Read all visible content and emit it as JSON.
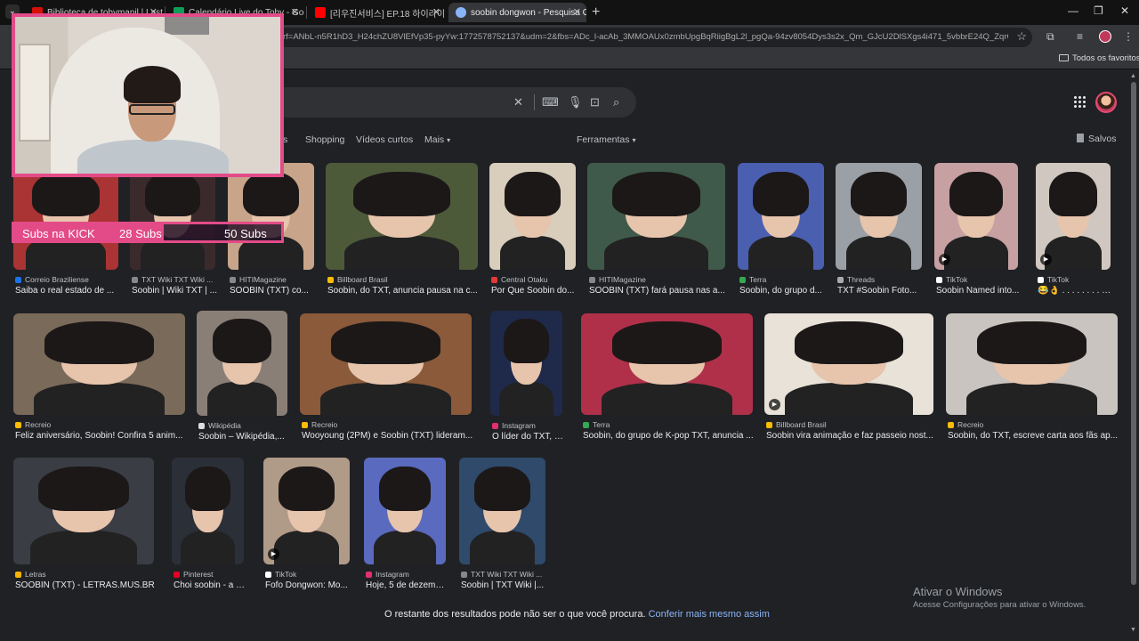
{
  "tabs": [
    {
      "title": "Biblioteca de tobymanil | Last.fm",
      "favicon_color": "#d51007"
    },
    {
      "title": "Calendário Live do Toby - Goo...",
      "favicon_color": "#0f9d58"
    },
    {
      "title": "[리우진서비스] EP.18 하이라이...",
      "favicon_color": "#ff0000"
    },
    {
      "title": "soobin dongwon - Pesquisa Go...",
      "favicon_color": "#8ab4f8"
    }
  ],
  "address_bar": {
    "url": "rf=ANbL-n5R1hD3_H24chZU8VlEfVp35-pyYw:1772578752137&udm=2&fbs=ADc_l-acAb_3MMOAUx0zmbUpgBqRiigBgL2l_pgQa-94zv8054Dys3s2x_Qm_GJcU2DlSXgs4i471_5vbbrE24Q_ZqrCatB7Y..."
  },
  "bookmarks": {
    "all_favorites": "Todos os favoritos"
  },
  "search": {
    "query": ""
  },
  "nav": {
    "images_partial": "s",
    "shopping": "Shopping",
    "short_videos": "Vídeos curtos",
    "more": "Mais",
    "tools": "Ferramentas",
    "saved": "Salvos"
  },
  "results": [
    {
      "source": "Correio Braziliense",
      "title": "Saiba o real estado de ...",
      "fav": "#1a73e8",
      "bg": "#a33",
      "video": false
    },
    {
      "source": "TXT Wiki TXT Wiki ...",
      "title": "Soobin | Wiki TXT | ...",
      "fav": "#888",
      "bg": "#3b2a2c",
      "video": false
    },
    {
      "source": "HITIMagazine",
      "title": "SOOBIN (TXT) co...",
      "fav": "#888",
      "bg": "#c8a58a",
      "video": false
    },
    {
      "source": "Billboard Brasil",
      "title": "Soobin, do TXT, anuncia pausa na c...",
      "fav": "#fbbc05",
      "bg": "#4d5a3a",
      "video": false
    },
    {
      "source": "Central Otaku",
      "title": "Por Que Soobin do...",
      "fav": "#e53935",
      "bg": "#d9cdbc",
      "video": false
    },
    {
      "source": "HITIMagazine",
      "title": "SOOBIN (TXT) fará pausa nas a...",
      "fav": "#888",
      "bg": "#3f5a4a",
      "video": false
    },
    {
      "source": "Terra",
      "title": "Soobin, do grupo d...",
      "fav": "#34a853",
      "bg": "#4a5fb0",
      "video": false
    },
    {
      "source": "Threads",
      "title": "TXT #Soobin Foto...",
      "fav": "#aaa",
      "bg": "#9aa0a6",
      "video": false
    },
    {
      "source": "TikTok",
      "title": "Soobin Named into...",
      "fav": "#fff",
      "bg": "#c7a0a2",
      "video": true
    },
    {
      "source": "TikTok",
      "title": "😂👌 . . . . . . . . #d...",
      "fav": "#fff",
      "bg": "#d0c8c0",
      "video": true
    },
    {
      "source": "Recreio",
      "title": "Feliz aniversário, Soobin! Confira 5 anim...",
      "fav": "#fbbc05",
      "bg": "#7a6a5a",
      "video": false
    },
    {
      "source": "Wikipédia",
      "title": "Soobin – Wikipédia,...",
      "fav": "#ddd",
      "bg": "#8a7f76",
      "video": false
    },
    {
      "source": "Recreio",
      "title": "Wooyoung (2PM) e Soobin (TXT) lideram...",
      "fav": "#fbbc05",
      "bg": "#8a5a3a",
      "video": false
    },
    {
      "source": "Instagram",
      "title": "O líder do TXT, So...",
      "fav": "#e1306c",
      "bg": "#1f2a4a",
      "video": false
    },
    {
      "source": "Terra",
      "title": "Soobin, do grupo de K-pop TXT, anuncia ...",
      "fav": "#34a853",
      "bg": "#b0304a",
      "video": false
    },
    {
      "source": "Billboard Brasil",
      "title": "Soobin vira animação e faz passeio nost...",
      "fav": "#fbbc05",
      "bg": "#e8e2d8",
      "video": true
    },
    {
      "source": "Recreio",
      "title": "Soobin, do TXT, escreve carta aos fãs ap...",
      "fav": "#fbbc05",
      "bg": "#c9c4bf",
      "video": false
    },
    {
      "source": "Letras",
      "title": "SOOBIN (TXT) - LETRAS.MUS.BR",
      "fav": "#f4b400",
      "bg": "#3a3d44",
      "video": false
    },
    {
      "source": "Pinterest",
      "title": "Choi soobin - a ha...",
      "fav": "#e60023",
      "bg": "#2b2f38",
      "video": false
    },
    {
      "source": "TikTok",
      "title": "Fofo Dongwon: Mo...",
      "fav": "#fff",
      "bg": "#b09a88",
      "video": true
    },
    {
      "source": "Instagram",
      "title": "Hoje, 5 de dezemb...",
      "fav": "#e1306c",
      "bg": "#5a6abf",
      "video": false
    },
    {
      "source": "TXT Wiki TXT Wiki ...",
      "title": "Soobin | TXT Wiki |...",
      "fav": "#888",
      "bg": "#2f4a6a",
      "video": false
    }
  ],
  "footer": {
    "text": "O restante dos resultados pode não ser o que você procura.",
    "link": "Conferir mais mesmo assim"
  },
  "windows_watermark": {
    "line1": "Ativar o Windows",
    "line2": "Acesse Configurações para ativar o Windows."
  },
  "stream_overlay": {
    "subs_label": "Subs na KICK",
    "current": "28 Subs",
    "goal": "50 Subs",
    "progress": 0.56,
    "accent": "#e34b88"
  }
}
